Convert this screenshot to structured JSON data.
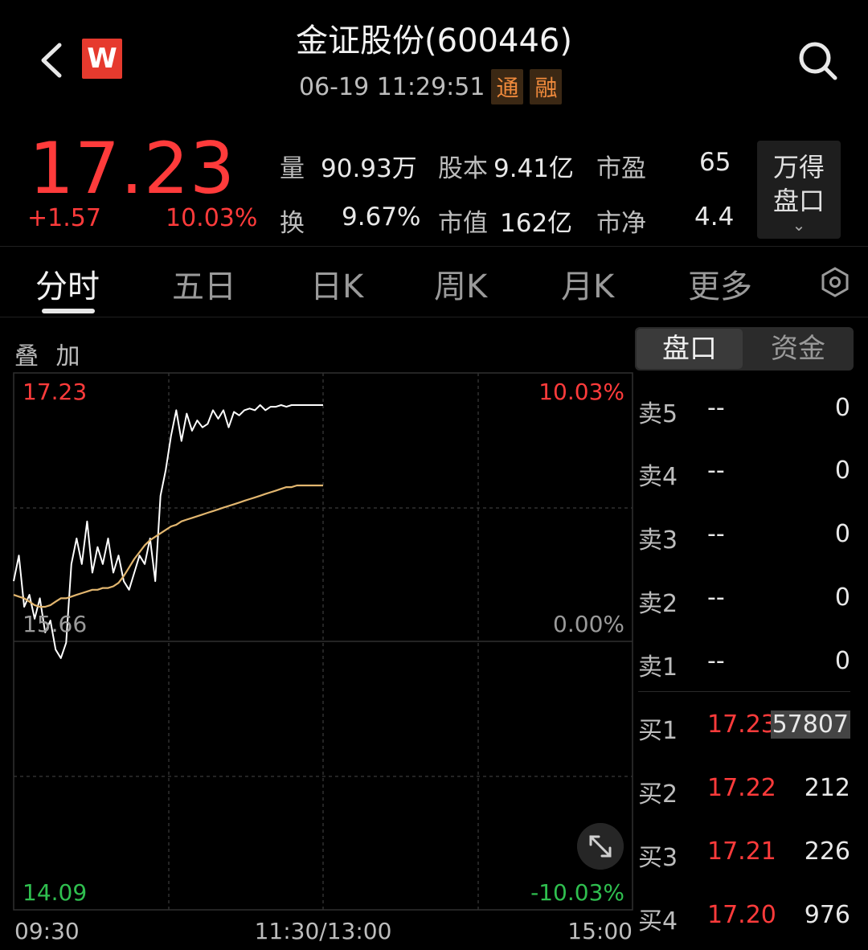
{
  "header": {
    "back_icon": "chevron-left-icon",
    "logo_letter": "W",
    "title": "金证股份(600446)",
    "timestamp": "06-19 11:29:51",
    "tags": [
      "通",
      "融"
    ],
    "search_icon": "search-icon"
  },
  "quote": {
    "price": "17.23",
    "change": "+1.57",
    "change_pct": "10.03%",
    "stats": {
      "volume_label": "量",
      "volume": "90.93万",
      "share_label": "股本",
      "share": "9.41亿",
      "pe_label": "市盈",
      "pe": "65",
      "turnover_label": "换",
      "turnover": "9.67%",
      "mcap_label": "市值",
      "mcap": "162亿",
      "pb_label": "市净",
      "pb": "4.4"
    },
    "wind_button": {
      "line1": "万得",
      "line2": "盘口"
    }
  },
  "tabs": [
    {
      "label": "分时",
      "active": true
    },
    {
      "label": "五日"
    },
    {
      "label": "日K"
    },
    {
      "label": "周K"
    },
    {
      "label": "月K"
    },
    {
      "label": "更多"
    }
  ],
  "chart": {
    "overlay_label": "叠 加",
    "y_top": "17.23",
    "y_mid": "15.66",
    "y_bottom": "14.09",
    "pct_top": "10.03%",
    "pct_mid": "0.00%",
    "pct_bottom": "-10.03%",
    "x_start": "09:30",
    "x_mid": "11:30/13:00",
    "x_end": "15:00",
    "price_color": "#ffffff",
    "avg_color": "#e2b66f"
  },
  "chart_data": {
    "type": "line",
    "ylim": [
      14.09,
      17.23
    ],
    "x_labels": [
      "09:30",
      "11:30/13:00",
      "15:00"
    ],
    "series": [
      {
        "values": [
          16.2,
          16.35,
          16.05,
          16.12,
          15.98,
          16.1,
          15.9,
          15.97,
          15.8,
          15.75,
          15.84,
          16.3,
          16.45,
          16.3,
          16.55,
          16.25,
          16.4,
          16.3,
          16.45,
          16.25,
          16.35,
          16.2,
          16.15,
          16.25,
          16.35,
          16.3,
          16.45,
          16.2,
          16.7,
          16.85,
          17.05,
          17.2,
          17.02,
          17.18,
          17.08,
          17.14,
          17.1,
          17.12,
          17.2,
          17.15,
          17.2,
          17.1,
          17.19,
          17.17,
          17.2,
          17.21,
          17.2,
          17.23,
          17.2,
          17.22,
          17.22,
          17.23,
          17.22,
          17.23,
          17.23,
          17.23,
          17.23,
          17.23,
          17.23,
          17.23
        ]
      },
      {
        "values": [
          16.12,
          16.11,
          16.1,
          16.08,
          16.06,
          16.05,
          16.05,
          16.06,
          16.08,
          16.1,
          16.1,
          16.11,
          16.12,
          16.13,
          16.14,
          16.15,
          16.15,
          16.16,
          16.16,
          16.17,
          16.19,
          16.23,
          16.28,
          16.33,
          16.37,
          16.41,
          16.44,
          16.46,
          16.48,
          16.5,
          16.52,
          16.53,
          16.55,
          16.56,
          16.57,
          16.58,
          16.59,
          16.6,
          16.61,
          16.62,
          16.63,
          16.64,
          16.65,
          16.66,
          16.67,
          16.68,
          16.69,
          16.7,
          16.71,
          16.72,
          16.73,
          16.74,
          16.75,
          16.75,
          16.76,
          16.76,
          16.76,
          16.76,
          16.76,
          16.76
        ]
      }
    ]
  },
  "orderbook": {
    "tab_active": "盘口",
    "tab_inactive": "资金",
    "asks": [
      {
        "label": "卖5",
        "price": "--",
        "vol": "0"
      },
      {
        "label": "卖4",
        "price": "--",
        "vol": "0"
      },
      {
        "label": "卖3",
        "price": "--",
        "vol": "0"
      },
      {
        "label": "卖2",
        "price": "--",
        "vol": "0"
      },
      {
        "label": "卖1",
        "price": "--",
        "vol": "0"
      }
    ],
    "bids": [
      {
        "label": "买1",
        "price": "17.23",
        "vol": "57807"
      },
      {
        "label": "买2",
        "price": "17.22",
        "vol": "212"
      },
      {
        "label": "买3",
        "price": "17.21",
        "vol": "226"
      },
      {
        "label": "买4",
        "price": "17.20",
        "vol": "976"
      }
    ]
  }
}
